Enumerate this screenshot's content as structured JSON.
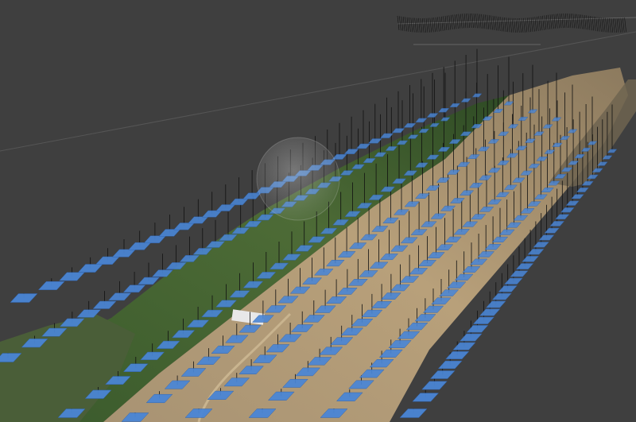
{
  "viewer": {
    "background_color": "#3f3f3f",
    "grid_color": "#5a5a5a",
    "camera_marker_color": "#4a86d6",
    "camera_marker_edge": "#2f63ad",
    "camera_stem_color": "#111111",
    "terrain_colors": {
      "sand": "#b39b75",
      "sand_dark": "#8f7a5a",
      "vegetation": "#3d5a2e",
      "vegetation_light": "#5c7a3e",
      "soil": "#7a6a55"
    },
    "navigation_sphere_color": "#d8d8d8",
    "icons": {
      "navigation_sphere": "navigation-sphere-icon"
    }
  }
}
